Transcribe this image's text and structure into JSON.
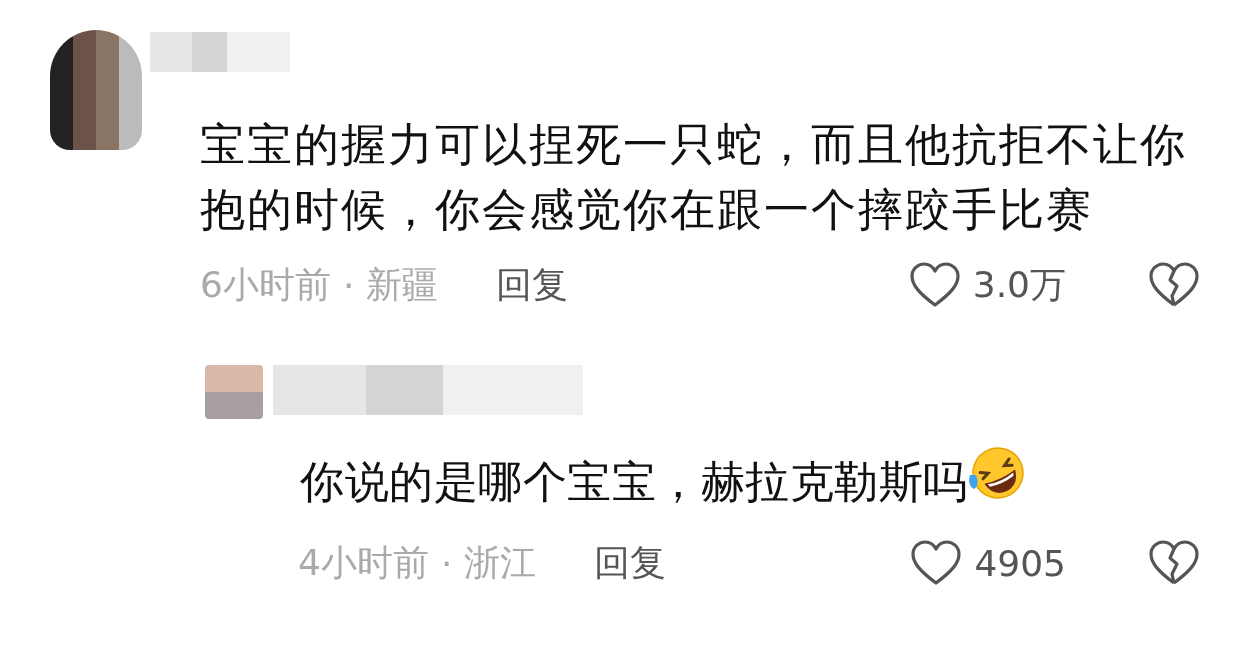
{
  "comments": [
    {
      "text": "宝宝的握力可以捏死一只蛇，而且他抗拒不让你抱的时候，你会感觉你在跟一个摔跤手比赛",
      "time": "6小时前",
      "separator": "·",
      "location": "新疆",
      "reply_label": "回复",
      "likes": "3.0万",
      "children": [
        {
          "text": "你说的是哪个宝宝，赫拉克勒斯吗",
          "laughing_emoji": true,
          "time": "4小时前",
          "separator": "·",
          "location": "浙江",
          "reply_label": "回复",
          "likes": "4905"
        }
      ]
    }
  ]
}
